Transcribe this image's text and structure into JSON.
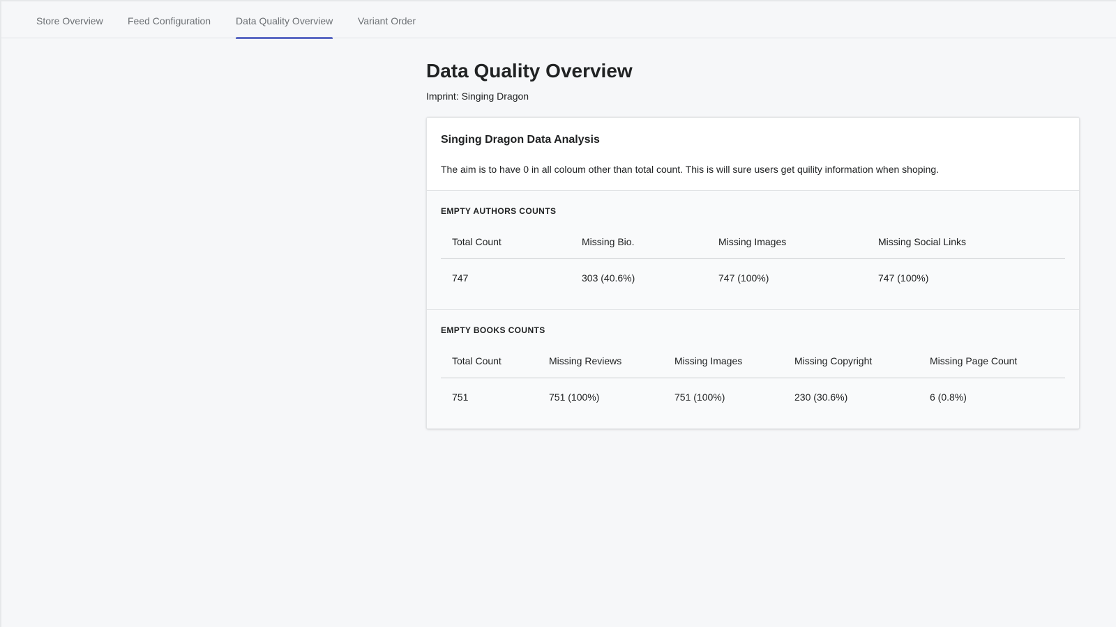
{
  "tabs": [
    {
      "label": "Store Overview"
    },
    {
      "label": "Feed Configuration"
    },
    {
      "label": "Data Quality Overview",
      "active": true
    },
    {
      "label": "Variant Order"
    }
  ],
  "page": {
    "title": "Data Quality Overview",
    "subtitle": "Imprint: Singing Dragon"
  },
  "card": {
    "title": "Singing Dragon Data Analysis",
    "description": "The aim is to have 0 in all coloum other than total count. This is will sure users get quility information when shoping."
  },
  "authors": {
    "label": "EMPTY AUTHORS COUNTS",
    "headers": [
      "Total Count",
      "Missing Bio.",
      "Missing Images",
      "Missing Social Links"
    ],
    "values": [
      "747",
      "303 (40.6%)",
      "747 (100%)",
      "747 (100%)"
    ]
  },
  "books": {
    "label": "EMPTY BOOKS COUNTS",
    "headers": [
      "Total Count",
      "Missing Reviews",
      "Missing Images",
      "Missing Copyright",
      "Missing Page Count"
    ],
    "values": [
      "751",
      "751 (100%)",
      "751 (100%)",
      "230 (30.6%)",
      "6 (0.8%)"
    ]
  },
  "colors": {
    "accent": "#5c6ac4",
    "background": "#f6f7f9",
    "text": "#202223",
    "muted": "#6d7175"
  }
}
